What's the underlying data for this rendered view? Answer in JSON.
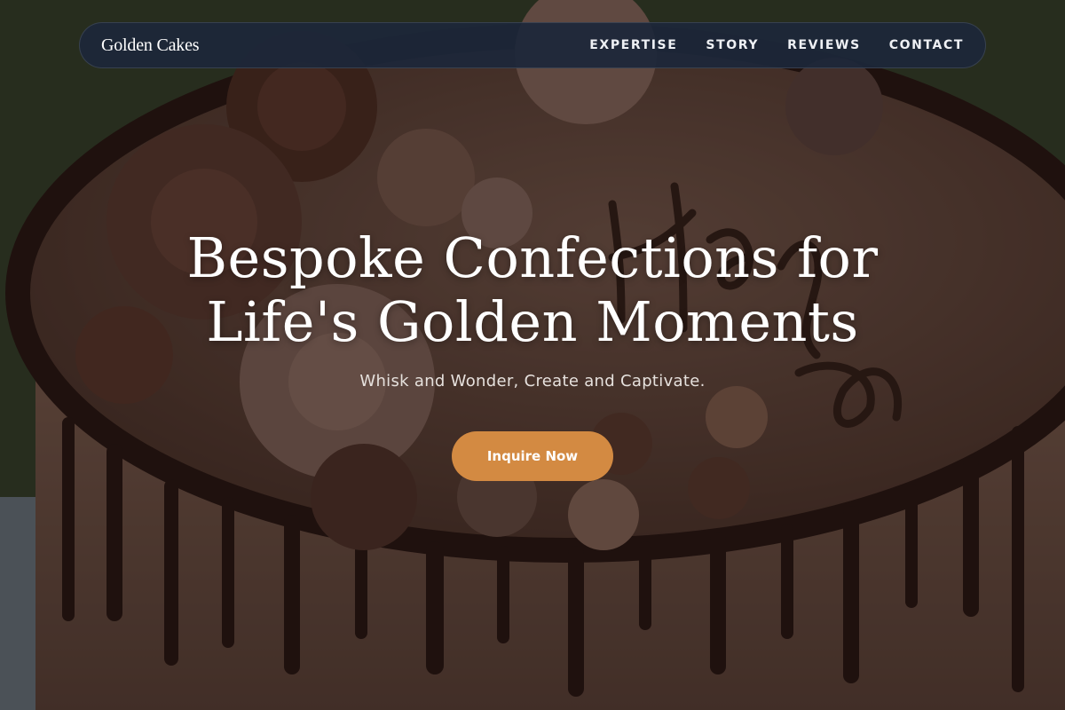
{
  "nav": {
    "brand": "Golden Cakes",
    "links": [
      "EXPERTISE",
      "STORY",
      "REVIEWS",
      "CONTACT"
    ]
  },
  "hero": {
    "title_line1": "Bespoke Confections for",
    "title_line2": "Life's Golden Moments",
    "subtitle": "Whisk and Wonder, Create and Captivate.",
    "cta_label": "Inquire Now",
    "background": "chocolate-drip-cake-photo"
  },
  "colors": {
    "nav_bg": "#1c273a",
    "accent": "#d38a42",
    "text": "#ffffff"
  }
}
